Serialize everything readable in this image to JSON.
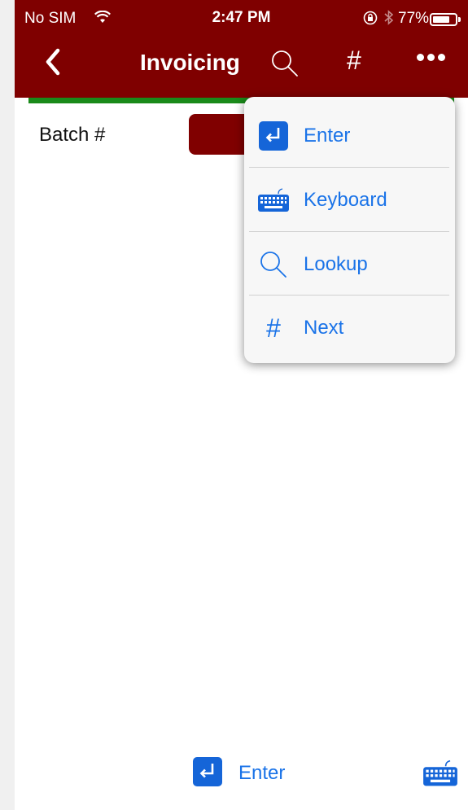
{
  "status_bar": {
    "carrier": "No SIM",
    "time": "2:47 PM",
    "battery_text": "77%",
    "battery_level": 0.77
  },
  "nav": {
    "title": "Invoicing",
    "back_icon": "chevron-left-icon",
    "search_icon": "search-icon",
    "hash_label": "#",
    "more_icon": "more-icon"
  },
  "form": {
    "batch_label": "Batch #"
  },
  "menu": {
    "items": [
      {
        "label": "Enter",
        "icon": "enter-icon"
      },
      {
        "label": "Keyboard",
        "icon": "keyboard-icon"
      },
      {
        "label": "Lookup",
        "icon": "search-icon"
      },
      {
        "label": "Next",
        "icon": "hash-icon"
      }
    ],
    "hash_glyph": "#"
  },
  "bottom_bar": {
    "enter_label": "Enter"
  },
  "colors": {
    "header": "#7f0000",
    "accent_green": "#1a8a1a",
    "link_blue": "#1a73e8",
    "icon_blue": "#1565d8"
  }
}
